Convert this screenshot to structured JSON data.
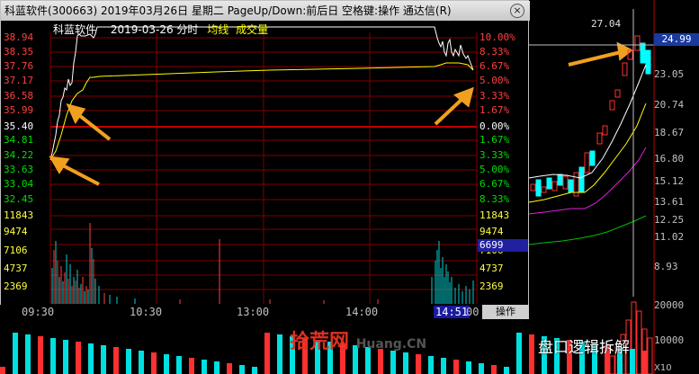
{
  "window": {
    "title": "科蓝软件(300663)  2019年03月26日 星期二  PageUp/Down:前后日 空格键:操作  通达信(R)",
    "close_glyph": "×"
  },
  "chart_header": {
    "stock_name": "科蓝软件",
    "date_label": "2019-03-26 分时",
    "avg_line_label": "均线",
    "volume_label": "成交量"
  },
  "left_price_axis": [
    "38.94",
    "38.35",
    "37.76",
    "37.17",
    "36.58",
    "35.99",
    "35.40",
    "34.81",
    "34.22",
    "33.63",
    "33.04",
    "32.45"
  ],
  "right_pct_axis": [
    "10.00%",
    "8.33%",
    "6.67%",
    "5.00%",
    "3.33%",
    "1.67%",
    "0.00%",
    "1.67%",
    "3.33%",
    "5.00%",
    "6.67%",
    "8.33%"
  ],
  "volume_axis": [
    "11843",
    "9474",
    "7106",
    "4737",
    "2369"
  ],
  "volume_readout": "6699",
  "time_axis": {
    "labels": [
      "09:30",
      "10:30",
      "13:00",
      "14:00"
    ],
    "cursor_time": "14:51",
    "end_time": "00",
    "operation_tab": "操作"
  },
  "daily_chart": {
    "peak_label": "27.04",
    "current_price": "24.99",
    "price_axis": [
      "23.05",
      "20.74",
      "18.67",
      "16.80",
      "15.12",
      "13.61",
      "12.25",
      "11.02",
      "8.93"
    ],
    "volume_axis": [
      "20000",
      "10000"
    ],
    "multiplier": "X10"
  },
  "watermark": {
    "site_cn": "拾荒网",
    "site_en": "Huang.CN"
  },
  "brand": "盘口逻辑拆解",
  "colors": {
    "up": "#ff3030",
    "down": "#00ffff",
    "grid": "#a00000",
    "price_line": "#ffffff",
    "avg_line": "#ffff00",
    "annotation_arrow": "#f0a020"
  }
}
